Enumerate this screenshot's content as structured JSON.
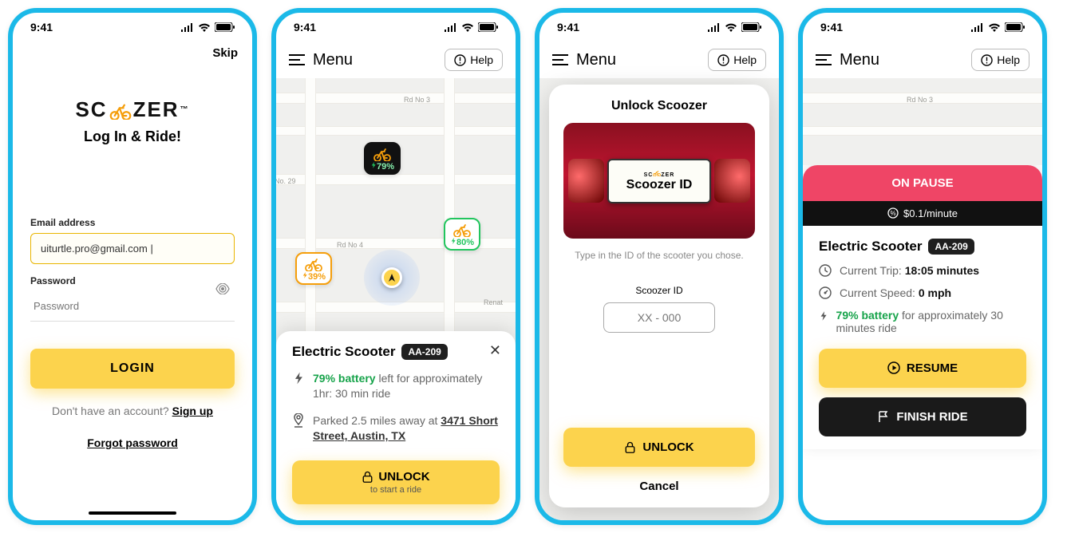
{
  "status": {
    "time": "9:41"
  },
  "header": {
    "menu": "Menu",
    "help": "Help",
    "skip": "Skip"
  },
  "s1": {
    "logo_l": "SC",
    "logo_r": "ZER",
    "subtitle": "Log In & Ride!",
    "email_label": "Email address",
    "email_value": "uiturtle.pro@gmail.com |",
    "password_label": "Password",
    "password_placeholder": "Password",
    "login": "LOGIN",
    "signup_prompt": "Don't have an account? ",
    "signup": "Sign up",
    "forgot": "Forgot password"
  },
  "map": {
    "road_label_1": "Rd No 3",
    "road_label_2": "No. 29",
    "road_label_3": "Rd No 4",
    "renat": "Renat",
    "markers": {
      "black": "79%",
      "green": "80%",
      "orange": "39%"
    }
  },
  "s2": {
    "title": "Electric Scooter",
    "badge": "AA-209",
    "battery_pct": "79% battery",
    "battery_rest": " left for approximately 1hr: 30 min ride",
    "parked_pre": "Parked 2.5 miles away at ",
    "address": "3471 Short Street, Austin, TX",
    "unlock": "UNLOCK",
    "unlock_sub": "to start a ride"
  },
  "s3": {
    "title": "Unlock Scoozer",
    "plate_small_l": "SC",
    "plate_small_r": "ZER",
    "plate_big": "Scoozer ID",
    "hint": "Type in the ID of the scooter you chose.",
    "id_label": "Scoozer ID",
    "id_placeholder": "XX - 000",
    "unlock": "UNLOCK",
    "cancel": "Cancel"
  },
  "s4": {
    "pause": "ON PAUSE",
    "rate": "$0.1/minute",
    "title": "Electric Scooter",
    "badge": "AA-209",
    "trip_label": "Current Trip: ",
    "trip_val": "18:05 minutes",
    "speed_label": "Current Speed: ",
    "speed_val": "0 mph",
    "batt_pct": "79% battery",
    "batt_rest": " for approximately 30 minutes ride",
    "resume": "RESUME",
    "finish": "FINISH RIDE"
  }
}
